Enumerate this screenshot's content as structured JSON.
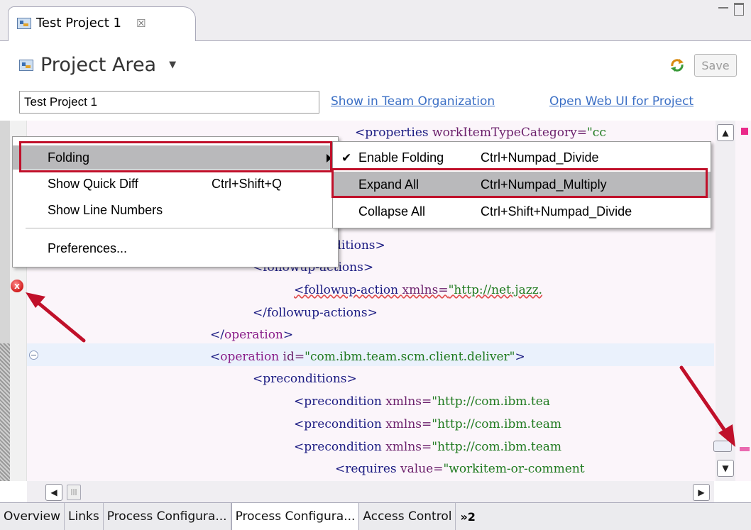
{
  "window": {
    "tab_title": "Test Project 1",
    "tab_close_glyph": "☒"
  },
  "header": {
    "section_title": "Project Area",
    "dropdown_glyph": "▼",
    "save_label": "Save",
    "name_value": "Test Project 1",
    "link_team_org": "Show in Team Organization",
    "link_web_ui": "Open Web UI for Project"
  },
  "editor": {
    "lines": {
      "l1_tag": "<properties ",
      "l1_attr": "workItemTypeCategory=",
      "l1_str": "\"cc",
      "l4": "ditions>",
      "l5": "<followup-actions>",
      "l6_tag": "<followup-action ",
      "l6_attr": "xmlns=",
      "l6_str": "\"http://net.jazz.",
      "l7": "</followup-actions>",
      "l8_open": "</",
      "l8_kw": "operation",
      "l8_close": ">",
      "l9_open": "<",
      "l9_kw": "operation ",
      "l9_attr": "id=",
      "l9_str": "\"com.ibm.team.scm.client.deliver\"",
      "l9_close": ">",
      "l10": "<preconditions>",
      "l11_tag": "<precondition ",
      "l11_attr": "xmlns=",
      "l11_str": "\"http://com.ibm.tea",
      "l12_tag": "<precondition ",
      "l12_attr": "xmlns=",
      "l12_str": "\"http://com.ibm.team",
      "l13_tag": "<precondition ",
      "l13_attr": "xmlns=",
      "l13_str": "\"http://com.ibm.team",
      "l14_tag": "<requires ",
      "l14_attr": "value=",
      "l14_str": "\"workitem-or-comment"
    },
    "error_marker_glyph": "x"
  },
  "context_menu": {
    "items": [
      {
        "label": "Folding",
        "shortcut": "",
        "submenu": true
      },
      {
        "label": "Show Quick Diff",
        "shortcut": "Ctrl+Shift+Q"
      },
      {
        "label": "Show Line Numbers",
        "shortcut": ""
      },
      {
        "label": "Preferences...",
        "shortcut": ""
      }
    ]
  },
  "submenu": {
    "items": [
      {
        "label": "Enable Folding",
        "shortcut": "Ctrl+Numpad_Divide",
        "checked": true
      },
      {
        "label": "Expand All",
        "shortcut": "Ctrl+Numpad_Multiply",
        "highlighted": true
      },
      {
        "label": "Collapse All",
        "shortcut": "Ctrl+Shift+Numpad_Divide"
      }
    ],
    "check_glyph": "✔"
  },
  "bottom_tabs": {
    "items": [
      "Overview",
      "Links",
      "Process Configura...",
      "Process Configura...",
      "Access Control"
    ],
    "overflow": "»2"
  },
  "colors": {
    "highlight_box": "#c0102a",
    "menu_highlight": "#b9b9bb",
    "link": "#3b6fc5",
    "error": "#d11d1d"
  }
}
